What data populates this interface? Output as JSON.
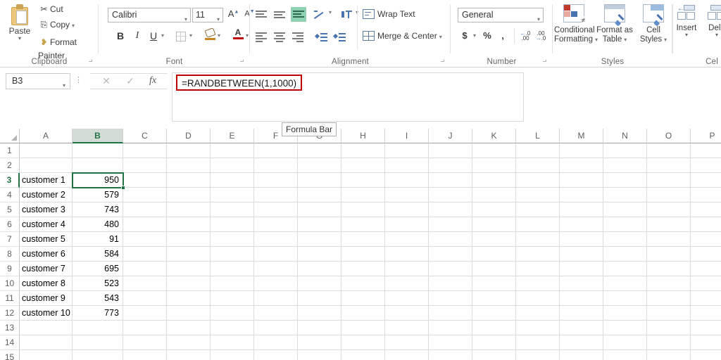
{
  "ribbon": {
    "clipboard": {
      "group_label": "Clipboard",
      "paste_label": "Paste",
      "cut_label": "Cut",
      "copy_label": "Copy",
      "format_painter_label": "Format Painter",
      "icons": [
        "paste-icon",
        "scissors-icon",
        "copy-icon",
        "paintbrush-icon"
      ]
    },
    "font": {
      "group_label": "Font",
      "font_name": "Calibri",
      "font_size": "11",
      "grow_font": "A",
      "shrink_font": "A",
      "bold": "B",
      "italic": "I",
      "underline": "U",
      "font_color_letter": "A",
      "font_color_hex": "#c00000",
      "fill_color_hex": "#c8851f"
    },
    "alignment": {
      "group_label": "Alignment",
      "wrap_text_label": "Wrap Text",
      "merge_center_label": "Merge & Center",
      "active_button": "bottom-align",
      "active_hex": "#8ed1b0"
    },
    "number": {
      "group_label": "Number",
      "format": "General",
      "currency": "$",
      "percent": "%",
      "comma": ",",
      "increase_decimal": ".00",
      "decrease_decimal": ".0"
    },
    "styles": {
      "group_label": "Styles",
      "conditional_formatting": "Conditional Formatting",
      "format_as_table": "Format as Table",
      "cell_styles": "Cell Styles"
    },
    "cells": {
      "group_label": "Cel",
      "insert": "Insert",
      "delete": "Dele"
    }
  },
  "formula_bar": {
    "name_box": "B3",
    "cancel_icon": "✕",
    "enter_icon": "✓",
    "fx_icon": "fx",
    "formula": "=RANDBETWEEN(1,1000)",
    "formula_border_hex": "#c00000",
    "tooltip": "Formula Bar"
  },
  "grid": {
    "selected_cell": "B3",
    "selection_hex": "#217346",
    "columns": [
      "A",
      "B",
      "C",
      "D",
      "E",
      "F",
      "G",
      "H",
      "I",
      "J",
      "K",
      "L",
      "M",
      "N",
      "O",
      "P"
    ],
    "rows": [
      "1",
      "2",
      "3",
      "4",
      "5",
      "6",
      "7",
      "8",
      "9",
      "10",
      "11",
      "12",
      "13",
      "14",
      "15"
    ],
    "cells": [
      {
        "row": "3",
        "a": "customer 1",
        "b": "950"
      },
      {
        "row": "4",
        "a": "customer 2",
        "b": "579"
      },
      {
        "row": "5",
        "a": "customer 3",
        "b": "743"
      },
      {
        "row": "6",
        "a": "customer 4",
        "b": "480"
      },
      {
        "row": "7",
        "a": "customer 5",
        "b": "91"
      },
      {
        "row": "8",
        "a": "customer 6",
        "b": "584"
      },
      {
        "row": "9",
        "a": "customer 7",
        "b": "695"
      },
      {
        "row": "10",
        "a": "customer 8",
        "b": "523"
      },
      {
        "row": "11",
        "a": "customer 9",
        "b": "543"
      },
      {
        "row": "12",
        "a": "customer 10",
        "b": "773"
      }
    ]
  }
}
